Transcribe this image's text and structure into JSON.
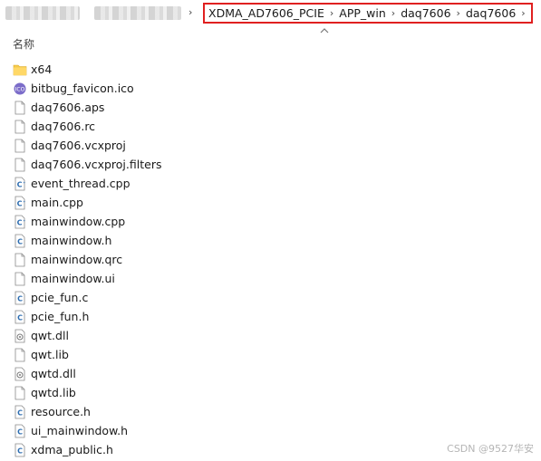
{
  "breadcrumb": [
    "XDMA_AD7606_PCIE",
    "APP_win",
    "daq7606",
    "daq7606"
  ],
  "column_header": "名称",
  "files": [
    {
      "name": "x64",
      "icon": "folder-icon"
    },
    {
      "name": "bitbug_favicon.ico",
      "icon": "ico-file-icon"
    },
    {
      "name": "daq7606.aps",
      "icon": "generic-file-icon"
    },
    {
      "name": "daq7606.rc",
      "icon": "generic-file-icon"
    },
    {
      "name": "daq7606.vcxproj",
      "icon": "generic-file-icon"
    },
    {
      "name": "daq7606.vcxproj.filters",
      "icon": "generic-file-icon"
    },
    {
      "name": "event_thread.cpp",
      "icon": "cpp-file-icon"
    },
    {
      "name": "main.cpp",
      "icon": "cpp-file-icon"
    },
    {
      "name": "mainwindow.cpp",
      "icon": "cpp-file-icon"
    },
    {
      "name": "mainwindow.h",
      "icon": "c-header-file-icon"
    },
    {
      "name": "mainwindow.qrc",
      "icon": "generic-file-icon"
    },
    {
      "name": "mainwindow.ui",
      "icon": "generic-file-icon"
    },
    {
      "name": "pcie_fun.c",
      "icon": "c-file-icon"
    },
    {
      "name": "pcie_fun.h",
      "icon": "c-header-file-icon"
    },
    {
      "name": "qwt.dll",
      "icon": "dll-file-icon"
    },
    {
      "name": "qwt.lib",
      "icon": "generic-file-icon"
    },
    {
      "name": "qwtd.dll",
      "icon": "dll-file-icon"
    },
    {
      "name": "qwtd.lib",
      "icon": "generic-file-icon"
    },
    {
      "name": "resource.h",
      "icon": "c-header-file-icon"
    },
    {
      "name": "ui_mainwindow.h",
      "icon": "c-header-file-icon"
    },
    {
      "name": "xdma_public.h",
      "icon": "c-header-file-icon"
    }
  ],
  "watermark": "CSDN @9527华安",
  "colors": {
    "highlight_border": "#e02020",
    "folder": "#f6cb4c",
    "c_icon": "#2b6cb0"
  }
}
